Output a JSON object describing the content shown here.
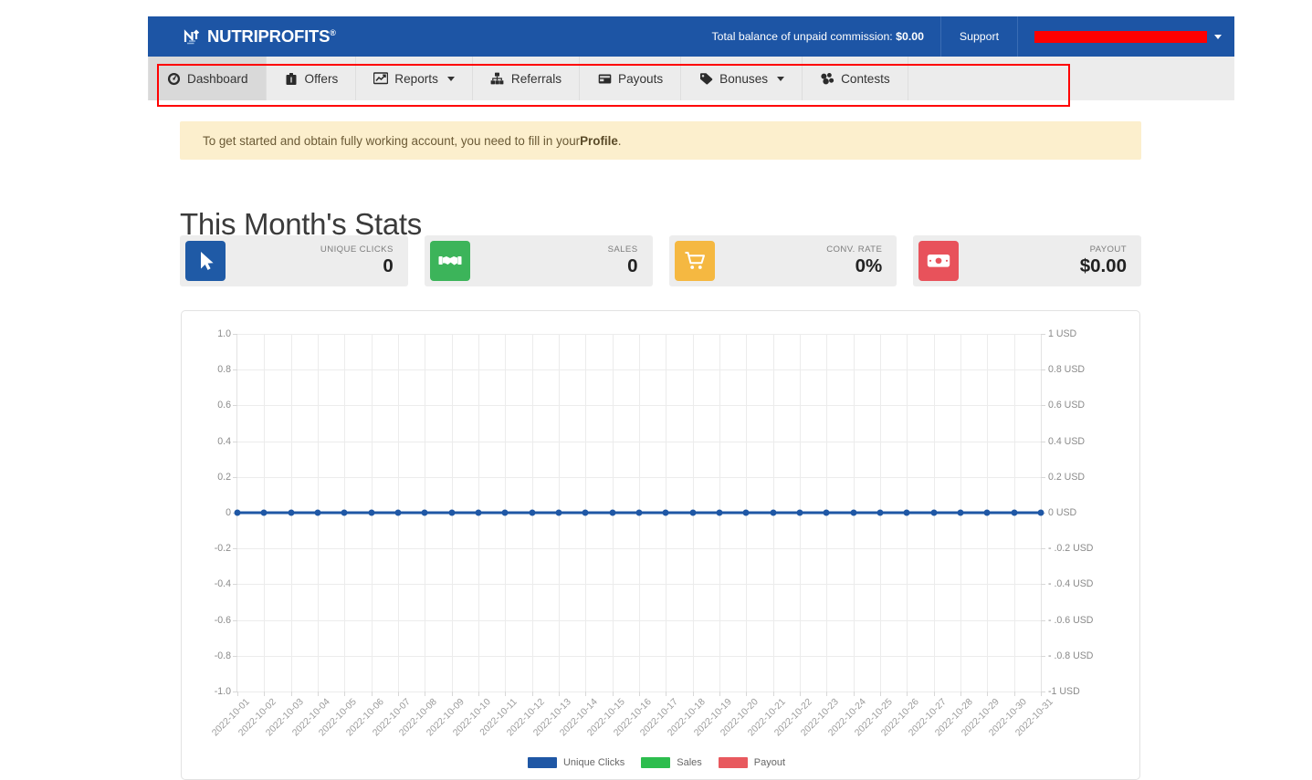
{
  "header": {
    "brand_name": "NUTRIPROFITS",
    "brand_trademark": "®",
    "balance_label": "Total balance of unpaid commission:",
    "balance_value": "$0.00",
    "support_label": "Support",
    "user_label": "",
    "user_redacted": true,
    "bg_color": "#1d55a5"
  },
  "nav": {
    "items": [
      {
        "label": "Dashboard",
        "icon": "dashboard-icon",
        "active": true,
        "caret": false
      },
      {
        "label": "Offers",
        "icon": "offers-icon",
        "active": false,
        "caret": false
      },
      {
        "label": "Reports",
        "icon": "reports-icon",
        "active": false,
        "caret": true
      },
      {
        "label": "Referrals",
        "icon": "referrals-icon",
        "active": false,
        "caret": false
      },
      {
        "label": "Payouts",
        "icon": "payouts-icon",
        "active": false,
        "caret": false
      },
      {
        "label": "Bonuses",
        "icon": "bonuses-icon",
        "active": false,
        "caret": true
      },
      {
        "label": "Contests",
        "icon": "contests-icon",
        "active": false,
        "caret": false
      }
    ],
    "annotation_color": "#ff0000"
  },
  "alert": {
    "text_before": "To get started and obtain fully working account, you need to fill in your ",
    "link_text": "Profile",
    "text_after": ".",
    "bg_color": "#fcefcd"
  },
  "main": {
    "title": "This Month's Stats",
    "stats": [
      {
        "label": "UNIQUE CLICKS",
        "value": "0",
        "icon": "cursor-icon",
        "color": "#1f5aa6"
      },
      {
        "label": "SALES",
        "value": "0",
        "icon": "handshake-icon",
        "color": "#3cb45a"
      },
      {
        "label": "CONV. RATE",
        "value": "0%",
        "icon": "cart-icon",
        "color": "#f5b841"
      },
      {
        "label": "PAYOUT",
        "value": "$0.00",
        "icon": "banknote-icon",
        "color": "#e8525b"
      }
    ]
  },
  "chart_data": {
    "type": "line",
    "title": "",
    "xlabel": "",
    "ylabel": "",
    "grid": true,
    "legend_position": "bottom",
    "ylim": [
      -1.0,
      1.0
    ],
    "y2lim": [
      -1.0,
      1.0
    ],
    "yticks": [
      "1.0",
      "0.8",
      "0.6",
      "0.4",
      "0.2",
      "0",
      "-0.2",
      "-0.4",
      "-0.6",
      "-0.8",
      "-1.0"
    ],
    "ytick_values": [
      1.0,
      0.8,
      0.6,
      0.4,
      0.2,
      0,
      -0.2,
      -0.4,
      -0.6,
      -0.8,
      -1.0
    ],
    "y2ticks": [
      "1 USD",
      "0.8 USD",
      "0.6 USD",
      "0.4 USD",
      "0.2 USD",
      "0 USD",
      "- .0.2 USD",
      "- .0.4 USD",
      "- .0.6 USD",
      "- .0.8 USD",
      "-1 USD"
    ],
    "categories": [
      "2022-10-01",
      "2022-10-02",
      "2022-10-03",
      "2022-10-04",
      "2022-10-05",
      "2022-10-06",
      "2022-10-07",
      "2022-10-08",
      "2022-10-09",
      "2022-10-10",
      "2022-10-11",
      "2022-10-12",
      "2022-10-13",
      "2022-10-14",
      "2022-10-15",
      "2022-10-16",
      "2022-10-17",
      "2022-10-18",
      "2022-10-19",
      "2022-10-20",
      "2022-10-21",
      "2022-10-22",
      "2022-10-23",
      "2022-10-24",
      "2022-10-25",
      "2022-10-26",
      "2022-10-27",
      "2022-10-28",
      "2022-10-29",
      "2022-10-30",
      "2022-10-31"
    ],
    "series": [
      {
        "name": "Unique Clicks",
        "color": "#1f57a5",
        "values": [
          0,
          0,
          0,
          0,
          0,
          0,
          0,
          0,
          0,
          0,
          0,
          0,
          0,
          0,
          0,
          0,
          0,
          0,
          0,
          0,
          0,
          0,
          0,
          0,
          0,
          0,
          0,
          0,
          0,
          0,
          0
        ]
      },
      {
        "name": "Sales",
        "color": "#2dbd4e",
        "values": [
          0,
          0,
          0,
          0,
          0,
          0,
          0,
          0,
          0,
          0,
          0,
          0,
          0,
          0,
          0,
          0,
          0,
          0,
          0,
          0,
          0,
          0,
          0,
          0,
          0,
          0,
          0,
          0,
          0,
          0,
          0
        ]
      },
      {
        "name": "Payout",
        "color": "#e8595e",
        "values": [
          0,
          0,
          0,
          0,
          0,
          0,
          0,
          0,
          0,
          0,
          0,
          0,
          0,
          0,
          0,
          0,
          0,
          0,
          0,
          0,
          0,
          0,
          0,
          0,
          0,
          0,
          0,
          0,
          0,
          0,
          0
        ]
      }
    ]
  }
}
